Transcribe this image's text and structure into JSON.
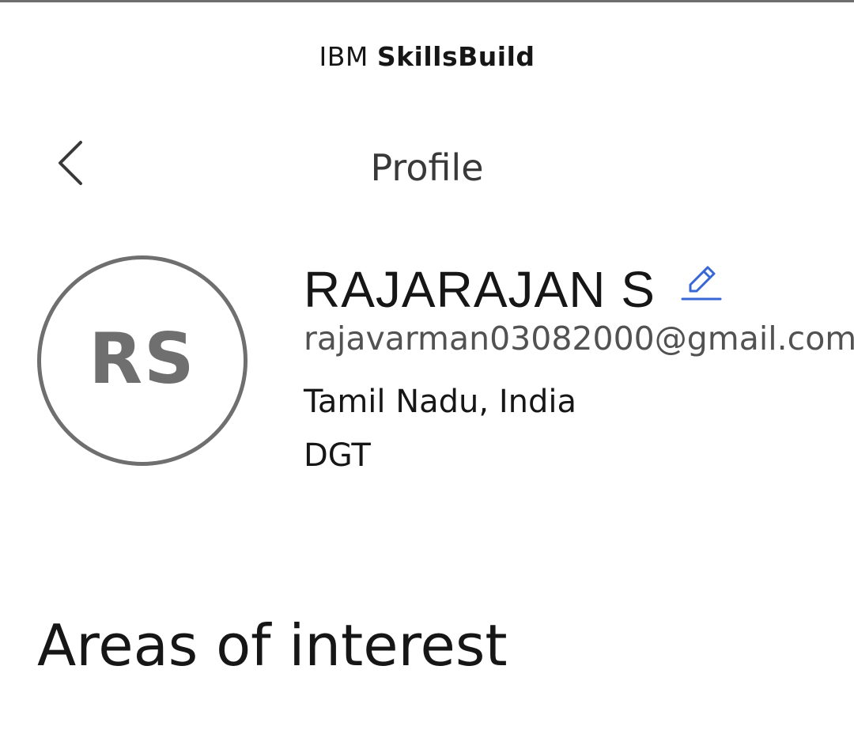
{
  "brand": {
    "prefix": "IBM",
    "name": "SkillsBuild"
  },
  "header": {
    "title": "Profile",
    "back_icon": "chevron-left-icon"
  },
  "profile": {
    "initials": "RS",
    "name": "RAJARAJAN S",
    "edit_icon": "pencil-edit-icon",
    "email": "rajavarman03082000@gmail.com",
    "location": "Tamil Nadu, India",
    "organization": "DGT"
  },
  "sections": {
    "areas_of_interest": "Areas of interest"
  },
  "colors": {
    "accent": "#3866d4",
    "avatar": "#6f6f6f",
    "text_primary": "#161616",
    "text_secondary": "#525252"
  }
}
